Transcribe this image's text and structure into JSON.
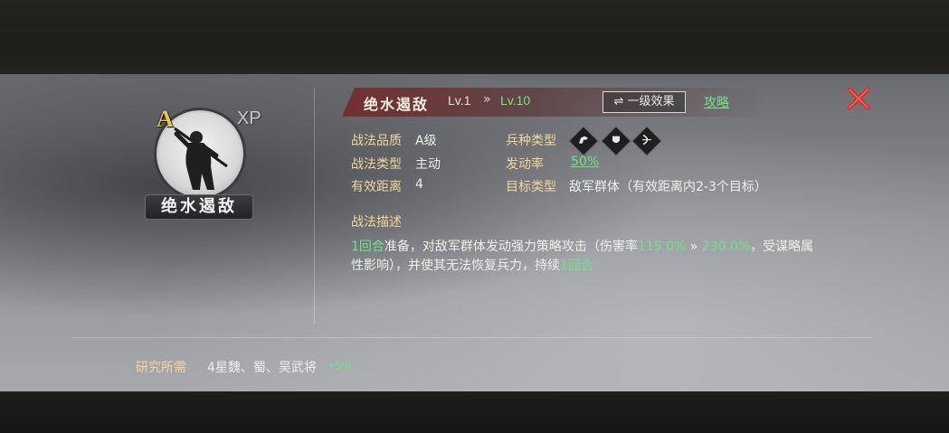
{
  "skill": {
    "name": "绝水遏敌",
    "grade": "A",
    "xp_label": "XP",
    "level_current": "Lv.1",
    "level_arrow": "»",
    "level_max": "Lv.10",
    "effect_button": "⇌ 一级效果",
    "guide_link": "攻略"
  },
  "info": {
    "quality_label": "战法品质",
    "quality_value": "A级",
    "type_label": "战法类型",
    "type_value": "主动",
    "range_label": "有效距离",
    "range_value": "4",
    "troop_label": "兵种类型",
    "rate_label": "发动率",
    "rate_value": "50%",
    "target_label": "目标类型",
    "target_value": "敌军群体（有效距离内2-3个目标）",
    "troop_icons": [
      "cavalry-icon",
      "shield-icon",
      "bow-icon"
    ]
  },
  "description": {
    "label": "战法描述",
    "rounds": "1回合",
    "text_a": "准备，对敌军群体发动强力策略攻击（伤害率",
    "rate_from": "115.0%",
    "arrow": " » ",
    "rate_to": "230.0%",
    "text_b": "，受谋略属性影响），并使其无法恢复兵力，持续",
    "rounds_end": "1回合"
  },
  "research": {
    "label": "研究所需",
    "value": "4星魏、蜀、吴武将",
    "bonus": "+5%"
  },
  "colors": {
    "accent_green": "#6fe38a",
    "label_gold": "#f0d79a",
    "close_red": "#d8322e",
    "grade_gold": "#e8c64c"
  }
}
